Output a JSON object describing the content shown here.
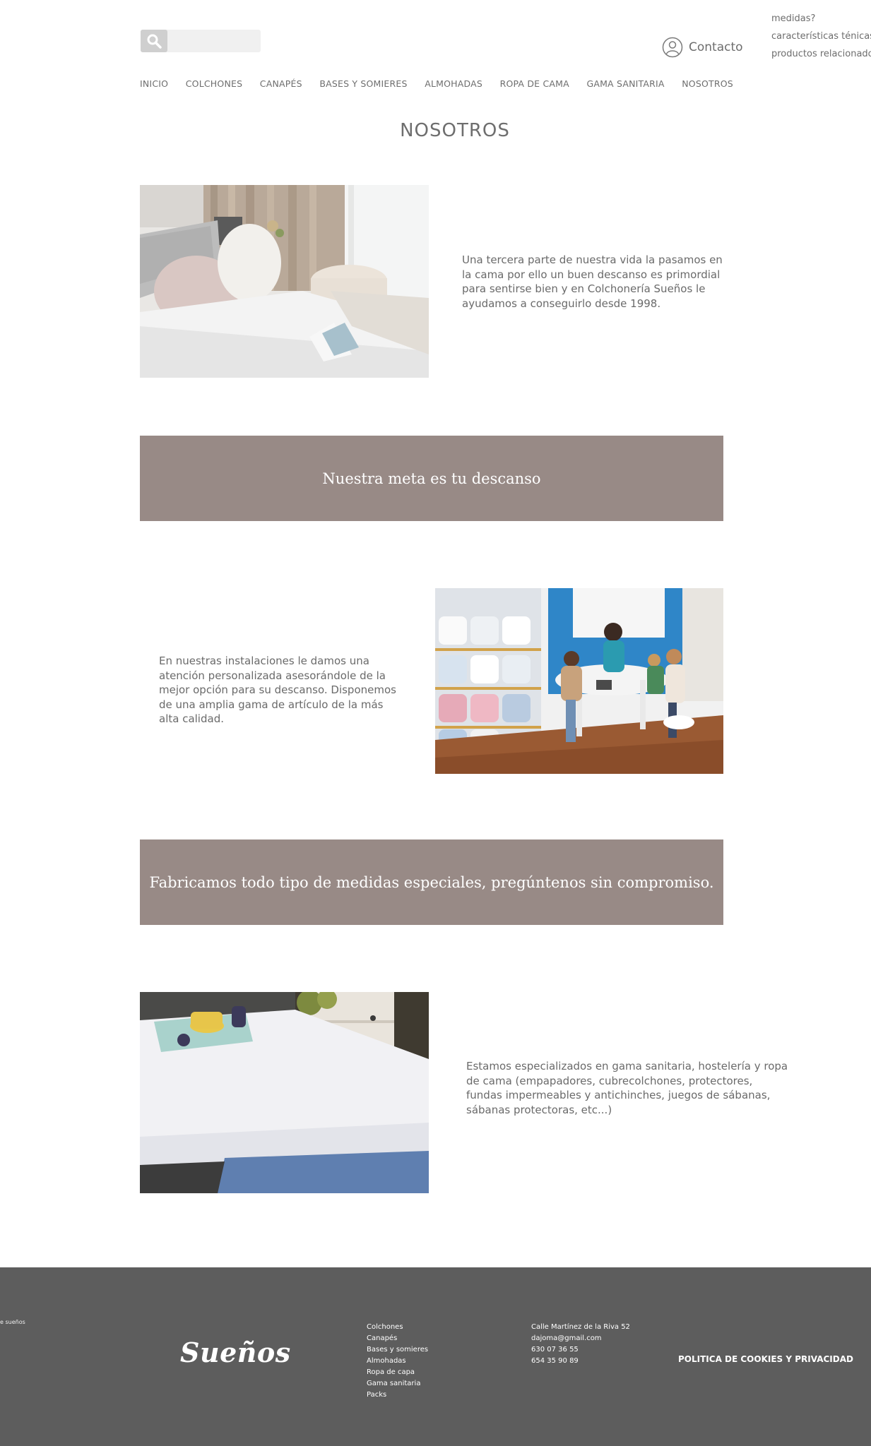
{
  "header": {
    "search_placeholder": "",
    "contact_label": "Contacto",
    "side_links": [
      "medidas?",
      "características ténicas?",
      "productos relacionado?"
    ]
  },
  "nav": {
    "items": [
      "INICIO",
      "COLCHONES",
      "CANAPÉS",
      "BASES Y SOMIERES",
      "ALMOHADAS",
      "ROPA DE CAMA",
      "GAMA SANITARIA",
      "NOSOTROS"
    ]
  },
  "page": {
    "title": "NOSOTROS"
  },
  "sections": {
    "intro_text": "Una tercera parte de nuestra vida la pasamos en la cama por ello un buen descanso es primordial para sentirse bien y en Colchonería Sueños le ayudamos a conseguirlo desde 1998.",
    "band1": "Nuestra meta es tu descanso",
    "service_text": "En nuestras instalaciones le damos una atención personalizada asesorándole de la mejor opción para su descanso. Disponemos de una amplia gama de artículo de la más alta calidad.",
    "band2": "Fabricamos todo tipo de medidas especiales, pregúntenos sin compromiso.",
    "sanitary_text": "Estamos especializados en gama sanitaria, hostelería y ropa de cama (empapadores, cubrecolchones, protectores, fundas impermeables y antichinches, juegos de sábanas, sábanas protectoras, etc...)"
  },
  "footer": {
    "tagline": "e sueños",
    "logo_text": "Sueños",
    "links": [
      "Colchones",
      "Canapés",
      "Bases y somieres",
      "Almohadas",
      "Ropa de capa",
      "Gama sanitaria",
      "Packs"
    ],
    "contact": [
      "Calle Martínez de la Riva 52",
      "dajoma@gmail.com",
      "630 07 36 55",
      "654 35 90 89"
    ],
    "policy": "POLITICA DE COOKIES Y PRIVACIDAD"
  },
  "colors": {
    "band": "#988a86",
    "footer": "#5d5d5d",
    "text": "#6a6a6a"
  }
}
